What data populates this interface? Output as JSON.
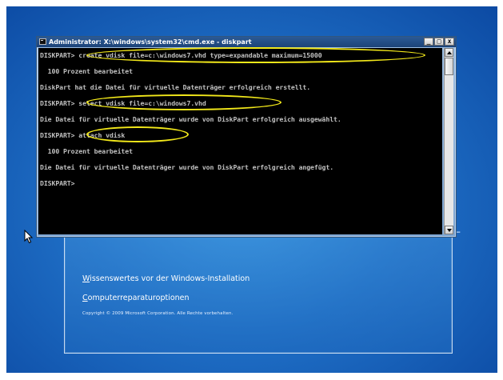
{
  "window": {
    "title": "Administrator: X:\\windows\\system32\\cmd.exe - diskpart",
    "minimize": "_",
    "maximize": "□",
    "close": "x"
  },
  "console": {
    "lines": [
      "DISKPART> create vdisk file=c:\\windows7.vhd type=expandable maximum=15000",
      "  100 Prozent bearbeitet",
      "DiskPart hat die Datei für virtuelle Datenträger erfolgreich erstellt.",
      "DISKPART> select vdisk file=c:\\windows7.vhd",
      "Die Datei für virtuelle Datenträger wurde von DiskPart erfolgreich ausgewählt.",
      "DISKPART> attach vdisk",
      "  100 Prozent bearbeitet",
      "Die Datei für virtuelle Datenträger wurde von DiskPart erfolgreich angefügt.",
      "DISKPART>"
    ]
  },
  "setup": {
    "link1_first": "W",
    "link1_rest": "issenswertes vor der Windows-Installation",
    "link2_first": "C",
    "link2_rest": "omputerreparaturoptionen",
    "copyright": "Copyright © 2009 Microsoft Corporation. Alle Rechte vorbehalten."
  },
  "colors": {
    "highlight": "#f2e81a",
    "console_bg": "#000000",
    "console_text": "#c0c0c0"
  },
  "icons": {
    "cursor": "arrow-cursor-icon",
    "window": "console-app-icon"
  }
}
